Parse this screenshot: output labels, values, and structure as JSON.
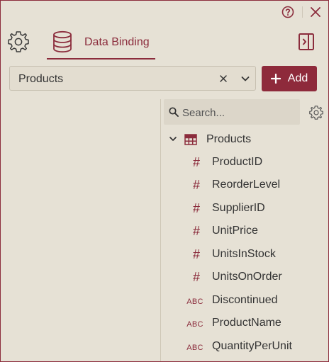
{
  "window": {
    "help_icon": "question-circle-icon",
    "close_icon": "close-icon"
  },
  "toolbar": {
    "settings_icon": "gear-icon",
    "tab_label": "Data Binding",
    "tab_icon": "database-icon",
    "panel_toggle_icon": "panel-right-icon"
  },
  "datasource": {
    "selected": "Products",
    "add_label": "Add"
  },
  "search": {
    "placeholder": "Search..."
  },
  "tree": {
    "root": "Products",
    "fields": [
      {
        "type": "#",
        "name": "ProductID"
      },
      {
        "type": "#",
        "name": "ReorderLevel"
      },
      {
        "type": "#",
        "name": "SupplierID"
      },
      {
        "type": "#",
        "name": "UnitPrice"
      },
      {
        "type": "#",
        "name": "UnitsInStock"
      },
      {
        "type": "#",
        "name": "UnitsOnOrder"
      },
      {
        "type": "ABC",
        "name": "Discontinued"
      },
      {
        "type": "ABC",
        "name": "ProductName"
      },
      {
        "type": "ABC",
        "name": "QuantityPerUnit"
      }
    ]
  },
  "colors": {
    "accent": "#8b2c3c",
    "background": "#e6e1d5"
  }
}
